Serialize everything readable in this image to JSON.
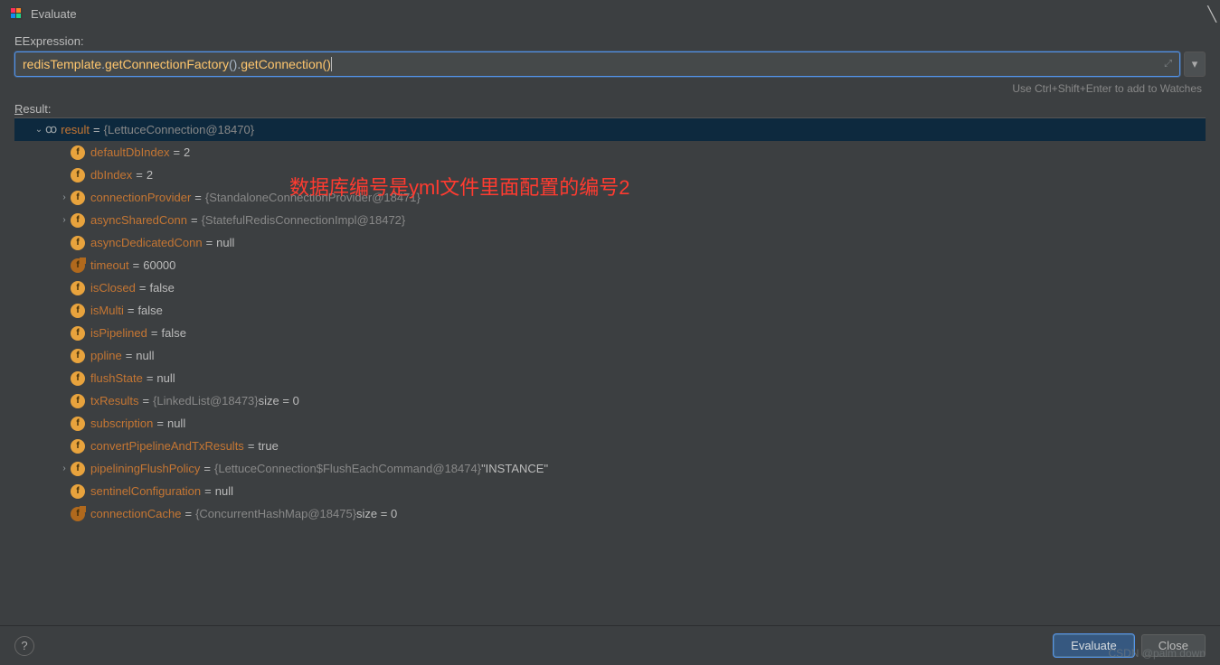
{
  "window": {
    "title": "Evaluate"
  },
  "labels": {
    "expression": "Expression:",
    "result": "Result:"
  },
  "expression": {
    "ident1": "redisTemplate",
    "dot1": ".",
    "ident2": "getConnectionFactory",
    "parens1": "()",
    "dot2": ".",
    "ident3": "getConnection",
    "open": "(",
    "close": ")"
  },
  "hint": "Use Ctrl+Shift+Enter to add to Watches",
  "annotation": "数据库编号是yml文件里面配置的编号2",
  "result_root": {
    "name": "result",
    "value": "{LettuceConnection@18470}"
  },
  "fields": [
    {
      "chev": "",
      "icon": "f",
      "name": "defaultDbIndex",
      "value_gray": "",
      "value_white": "2"
    },
    {
      "chev": "",
      "icon": "f",
      "name": "dbIndex",
      "value_gray": "",
      "value_white": "2"
    },
    {
      "chev": "›",
      "icon": "f",
      "name": "connectionProvider",
      "value_gray": "{StandaloneConnectionProvider@18471}",
      "value_white": ""
    },
    {
      "chev": "›",
      "icon": "f",
      "name": "asyncSharedConn",
      "value_gray": "{StatefulRedisConnectionImpl@18472}",
      "value_white": ""
    },
    {
      "chev": "",
      "icon": "f",
      "name": "asyncDedicatedConn",
      "value_gray": "",
      "value_white": "null"
    },
    {
      "chev": "",
      "icon": "fd",
      "name": "timeout",
      "value_gray": "",
      "value_white": "60000"
    },
    {
      "chev": "",
      "icon": "f",
      "name": "isClosed",
      "value_gray": "",
      "value_white": "false"
    },
    {
      "chev": "",
      "icon": "f",
      "name": "isMulti",
      "value_gray": "",
      "value_white": "false"
    },
    {
      "chev": "",
      "icon": "f",
      "name": "isPipelined",
      "value_gray": "",
      "value_white": "false"
    },
    {
      "chev": "",
      "icon": "f",
      "name": "ppline",
      "value_gray": "",
      "value_white": "null"
    },
    {
      "chev": "",
      "icon": "f",
      "name": "flushState",
      "value_gray": "",
      "value_white": "null"
    },
    {
      "chev": "",
      "icon": "f",
      "name": "txResults",
      "value_gray": "{LinkedList@18473}",
      "value_white": "  size = 0"
    },
    {
      "chev": "",
      "icon": "f",
      "name": "subscription",
      "value_gray": "",
      "value_white": "null"
    },
    {
      "chev": "",
      "icon": "f",
      "name": "convertPipelineAndTxResults",
      "value_gray": "",
      "value_white": "true"
    },
    {
      "chev": "›",
      "icon": "f",
      "name": "pipeliningFlushPolicy",
      "value_gray": "{LettuceConnection$FlushEachCommand@18474}",
      "value_white": " \"INSTANCE\""
    },
    {
      "chev": "",
      "icon": "f",
      "name": "sentinelConfiguration",
      "value_gray": "",
      "value_white": "null"
    },
    {
      "chev": "",
      "icon": "fd",
      "name": "connectionCache",
      "value_gray": "{ConcurrentHashMap@18475}",
      "value_white": "  size = 0"
    }
  ],
  "footer": {
    "evaluate": "Evaluate",
    "close": "Close"
  },
  "watermark": "CSDN @palm down"
}
